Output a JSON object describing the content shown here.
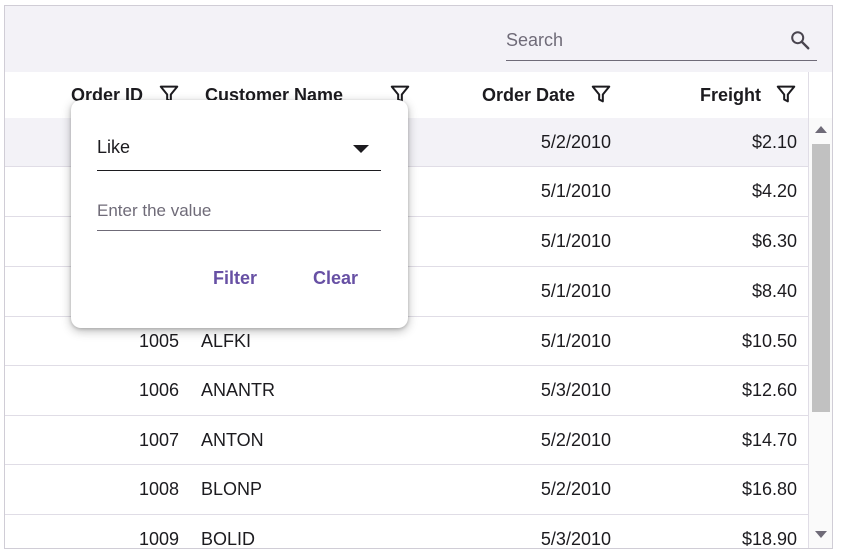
{
  "toolbar": {
    "search_placeholder": "Search"
  },
  "columns": {
    "order_id": "Order ID",
    "customer_name": "Customer Name",
    "order_date": "Order Date",
    "freight": "Freight"
  },
  "rows": [
    {
      "id": "",
      "name": "",
      "date": "5/2/2010",
      "freight": "$2.10"
    },
    {
      "id": "",
      "name": "",
      "date": "5/1/2010",
      "freight": "$4.20"
    },
    {
      "id": "",
      "name": "",
      "date": "5/1/2010",
      "freight": "$6.30"
    },
    {
      "id": "",
      "name": "",
      "date": "5/1/2010",
      "freight": "$8.40"
    },
    {
      "id": "1005",
      "name": "ALFKI",
      "date": "5/1/2010",
      "freight": "$10.50"
    },
    {
      "id": "1006",
      "name": "ANANTR",
      "date": "5/3/2010",
      "freight": "$12.60"
    },
    {
      "id": "1007",
      "name": "ANTON",
      "date": "5/2/2010",
      "freight": "$14.70"
    },
    {
      "id": "1008",
      "name": "BLONP",
      "date": "5/2/2010",
      "freight": "$16.80"
    },
    {
      "id": "1009",
      "name": "BOLID",
      "date": "5/3/2010",
      "freight": "$18.90"
    }
  ],
  "filter_popup": {
    "operator": "Like",
    "value_placeholder": "Enter the value",
    "filter_label": "Filter",
    "clear_label": "Clear"
  },
  "icons": {
    "search": "search-icon",
    "filter": "filter-icon",
    "dropdown": "chevron-down-icon"
  },
  "colors": {
    "accent": "#6750a4",
    "toolbar_bg": "#f3f2f7",
    "selected_row_bg": "#f3f2f7"
  }
}
